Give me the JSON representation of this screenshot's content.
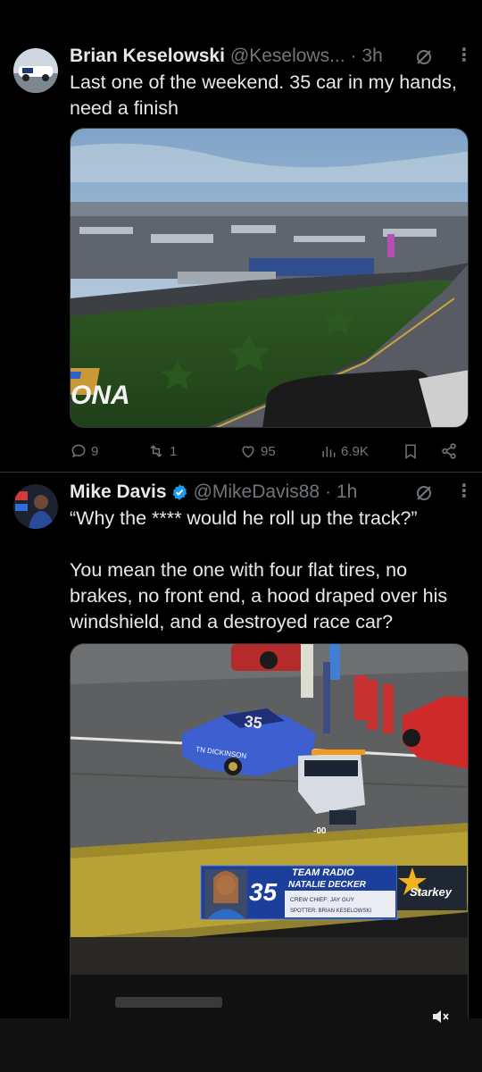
{
  "tweets": [
    {
      "name": "Brian Keselowski",
      "handle": "@Keselows...",
      "time": "· 3h",
      "text": "Last one of the weekend. 35 car in my hands, need a finish",
      "media_text": "ONA",
      "stats": {
        "replies": "9",
        "retweets": "1",
        "likes": "95",
        "views": "6.9K"
      }
    },
    {
      "name": "Mike Davis",
      "handle": "@MikeDavis88",
      "time": "· 1h",
      "text": "“Why the **** would he roll up the track?”\n\nYou mean the one with four flat tires, no brakes, no front end, a hood draped over his windshield, and a destroyed race car?",
      "media": {
        "car_number": "35",
        "car_sponsor": "TN DICKINSON",
        "truck_number": "-00",
        "radio_title": "TEAM RADIO",
        "radio_name": "NATALIE DECKER",
        "radio_crew": "CREW CHIEF: JAY GUY",
        "radio_spotter": "SPOTTER: BRIAN KESELOWSKI",
        "sponsor_logo": "Starkey",
        "overlay_number": "35"
      }
    }
  ],
  "colors": {
    "background": "#000000",
    "text": "#e7e9ea",
    "secondary": "#71767b",
    "verified": "#1d9bf0",
    "divider": "#2f3336"
  }
}
